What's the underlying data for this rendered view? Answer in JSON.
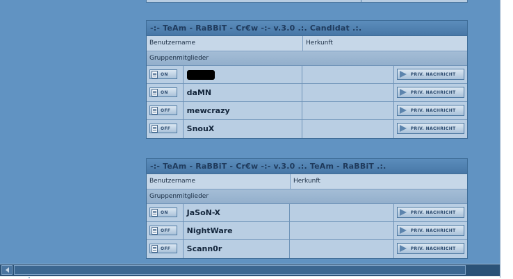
{
  "groups": [
    {
      "title": "-:- TeAm - RaBBiT - Cr€w -:- v.3.0 .:. Candidat .:.",
      "col_username": "Benutzername",
      "col_origin": "Herkunft",
      "section_label": "Gruppenmitglieder",
      "members": [
        {
          "status": "ON",
          "name": "",
          "redacted": true,
          "origin": "",
          "pm_label": "PRIV. NACHRICHT"
        },
        {
          "status": "ON",
          "name": "daMN",
          "origin": "",
          "pm_label": "PRIV. NACHRICHT"
        },
        {
          "status": "OFF",
          "name": "mewcrazy",
          "origin": "",
          "pm_label": "PRIV. NACHRICHT"
        },
        {
          "status": "OFF",
          "name": "SnouX",
          "origin": "",
          "pm_label": "PRIV. NACHRICHT"
        }
      ]
    },
    {
      "title": "-:- TeAm - RaBBiT - Cr€w -:- v.3.0 .:. TeAm - RaBBiT .:.",
      "col_username": "Benutzername",
      "col_origin": "Herkunft",
      "section_label": "Gruppenmitglieder",
      "members": [
        {
          "status": "ON",
          "name": "JaSoN-X",
          "origin": "",
          "pm_label": "PRIV. NACHRICHT"
        },
        {
          "status": "OFF",
          "name": "NightWare",
          "origin": "",
          "pm_label": "PRIV. NACHRICHT"
        },
        {
          "status": "OFF",
          "name": "Scann0r",
          "origin": "",
          "pm_label": "PRIV. NACHRICHT"
        }
      ]
    }
  ],
  "colors": {
    "page_bg": "#6193c2",
    "header_bg": "#4f7fb0",
    "row_bg": "#b9cee3",
    "scrollbar_bg": "#2b5277"
  },
  "icons": {
    "status": "profile-document-icon",
    "pm": "send-arrow-icon",
    "scroll_left": "arrow-left-icon"
  }
}
